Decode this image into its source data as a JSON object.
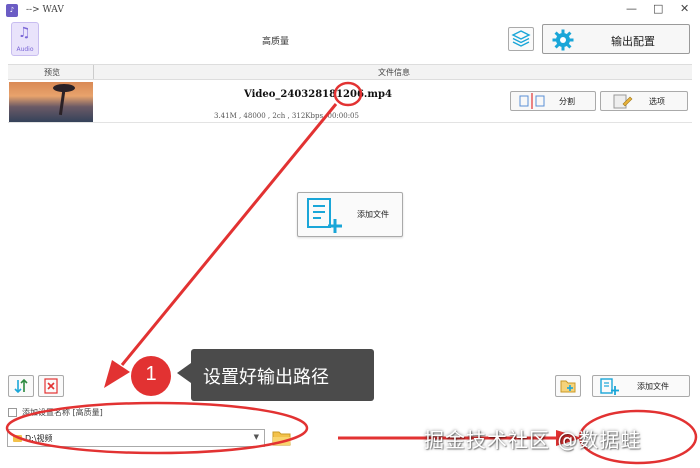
{
  "window": {
    "title": "--> WAV",
    "minimize": "—",
    "maximize": "□",
    "close": "✕"
  },
  "toolbar": {
    "format_label": "Audio",
    "quality": "高质量",
    "output_button": "输出配置"
  },
  "file_list": {
    "headers": [
      "预览",
      "文件信息"
    ],
    "files": [
      {
        "name": "Video_240328181206.mp4",
        "info": "3.41M , 48000 , 2ch , 312Kbps, 00:00:05",
        "split_label": "分割",
        "options_label": "选项"
      }
    ]
  },
  "add_file_center": "添加文件",
  "bottom": {
    "add_settings_label": "添加设置名称 [高质量]",
    "add_file_label": "添加文件",
    "output_path": "D:\\视频"
  },
  "annotation": {
    "step_number": "1",
    "callout_text": "设置好输出路径"
  },
  "watermark": "掘金技术社区 @数据蛙",
  "colors": {
    "annotation_red": "#e23232",
    "callout_bg": "#4b4b4b",
    "accent_blue": "#1aa6d8"
  }
}
